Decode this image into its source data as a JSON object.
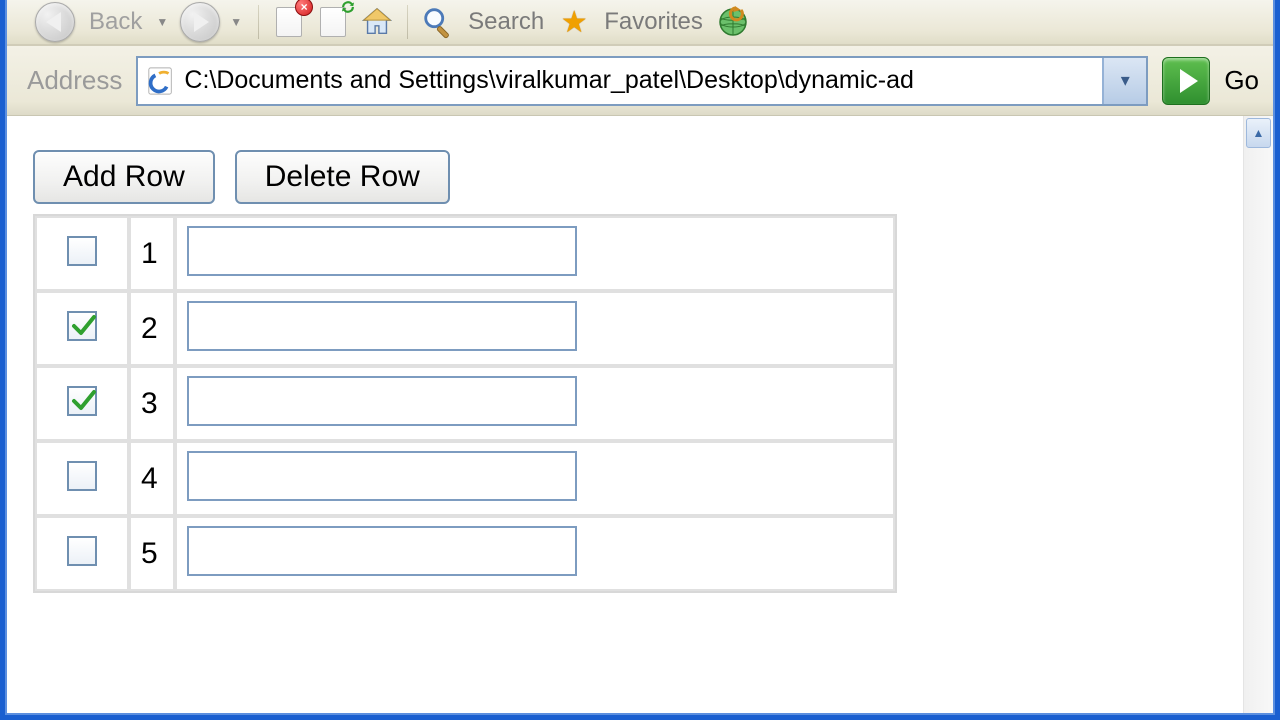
{
  "toolbar": {
    "back_label": "Back",
    "search_label": "Search",
    "favorites_label": "Favorites"
  },
  "address": {
    "label": "Address",
    "value": "C:\\Documents and Settings\\viralkumar_patel\\Desktop\\dynamic-ad",
    "go_label": "Go"
  },
  "actions": {
    "add_row_label": "Add Row",
    "delete_row_label": "Delete Row"
  },
  "rows": [
    {
      "num": "1",
      "checked": false,
      "value": ""
    },
    {
      "num": "2",
      "checked": true,
      "value": ""
    },
    {
      "num": "3",
      "checked": true,
      "value": ""
    },
    {
      "num": "4",
      "checked": false,
      "value": ""
    },
    {
      "num": "5",
      "checked": false,
      "value": ""
    }
  ]
}
